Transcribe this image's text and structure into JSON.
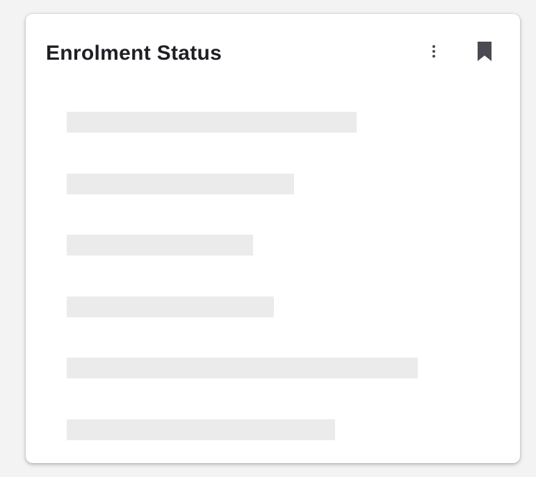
{
  "card": {
    "title": "Enrolment Status",
    "more_icon": "more-vert-icon",
    "bookmark_icon": "bookmark-icon",
    "icon_color": "#4a4a52",
    "state": "loading"
  },
  "skeleton": {
    "color": "#ebebeb",
    "bar_fill_fractions": [
      0.672,
      0.528,
      0.432,
      0.48,
      0.815,
      0.623
    ]
  }
}
